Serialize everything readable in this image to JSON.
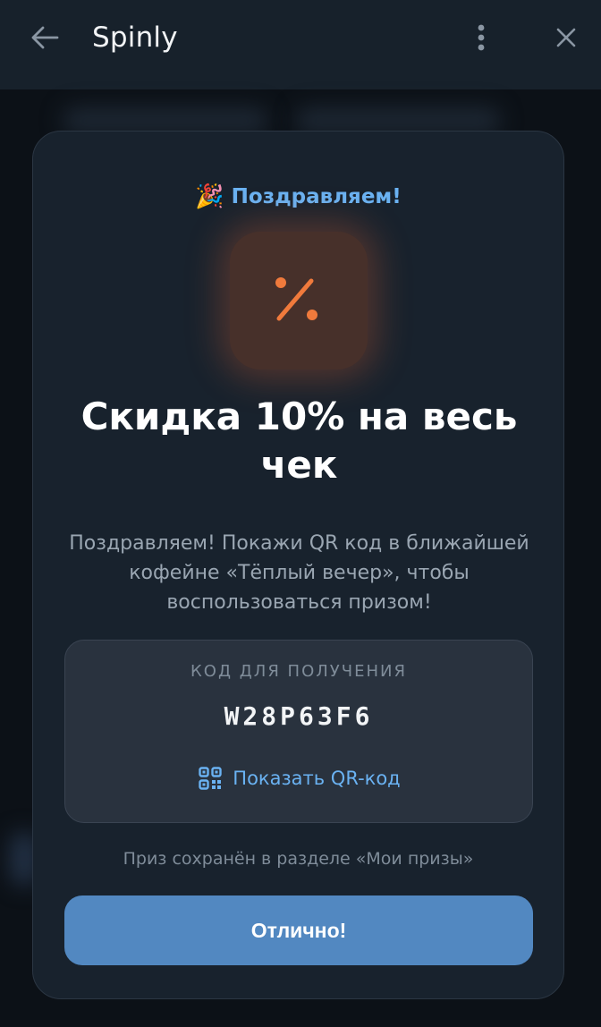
{
  "header": {
    "title": "Spinly"
  },
  "card": {
    "congrats": "Поздравляем!",
    "prize_title": "Скидка 10% на весь чек",
    "description": "Поздравляем! Покажи QR код в ближайшей кофейне «Тёплый вечер», чтобы воспользоваться призом!",
    "code_label": "КОД ДЛЯ ПОЛУЧЕНИЯ",
    "code_value": "W28P63F6",
    "qr_button": "Показать QR-код",
    "saved_note": "Приз сохранён в разделе «Мои призы»",
    "ok_button": "Отлично!"
  },
  "colors": {
    "accent": "#6ab2f2",
    "button": "#5288c1",
    "discount_orange": "#f07a3c"
  },
  "icons": {
    "back": "arrow-left-icon",
    "more": "more-vertical-icon",
    "close": "close-icon",
    "party": "party-popper-icon",
    "discount": "percent-icon",
    "qr": "qr-code-icon"
  }
}
